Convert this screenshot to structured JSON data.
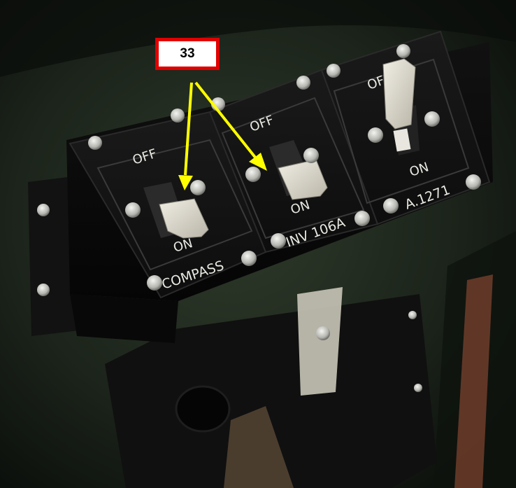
{
  "callout": {
    "number": "33",
    "box_border_color": "#e00000",
    "arrow_color": "#ffff00"
  },
  "panels": [
    {
      "name": "compass",
      "off_label": "OFF",
      "on_label": "ON",
      "placard": "COMPASS"
    },
    {
      "name": "inverter",
      "off_label": "OFF",
      "on_label": "ON",
      "placard": "INV 106A"
    },
    {
      "name": "third",
      "off_label": "OF",
      "on_label": "ON",
      "placard": "A.1271"
    }
  ]
}
